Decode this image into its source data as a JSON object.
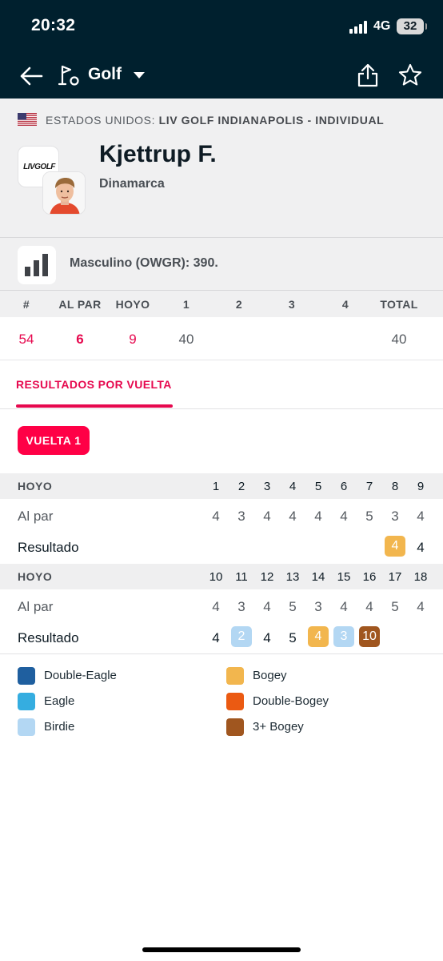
{
  "status_bar": {
    "time": "20:32",
    "network": "4G",
    "battery": "32"
  },
  "nav": {
    "title": "Golf"
  },
  "event": {
    "country": "ESTADOS UNIDOS:",
    "tournament": "LIV GOLF INDIANAPOLIS - INDIVIDUAL",
    "logo_text": "LIVGOLF"
  },
  "player": {
    "name": "Kjettrup F.",
    "country": "Dinamarca"
  },
  "ranking": {
    "text": "Masculino (OWGR): 390."
  },
  "summary": {
    "headers": [
      "#",
      "AL PAR",
      "HOYO",
      "1",
      "2",
      "3",
      "4",
      "TOTAL"
    ],
    "values": [
      "54",
      "6",
      "9",
      "40",
      "",
      "",
      "",
      "40"
    ]
  },
  "tabs": {
    "active": "RESULTADOS POR VUELTA"
  },
  "round_button": "VUELTA 1",
  "scorecard": {
    "hole_label": "HOYO",
    "par_label": "Al par",
    "result_label": "Resultado",
    "front": {
      "holes": [
        "1",
        "2",
        "3",
        "4",
        "5",
        "6",
        "7",
        "8",
        "9"
      ],
      "par": [
        "4",
        "3",
        "4",
        "4",
        "4",
        "4",
        "5",
        "3",
        "4"
      ],
      "result": [
        "",
        "",
        "",
        "",
        "",
        "",
        "",
        "4",
        "4"
      ],
      "result_types": [
        "",
        "",
        "",
        "",
        "",
        "",
        "",
        "bogey",
        "par"
      ]
    },
    "back": {
      "holes": [
        "10",
        "11",
        "12",
        "13",
        "14",
        "15",
        "16",
        "17",
        "18"
      ],
      "par": [
        "4",
        "3",
        "4",
        "5",
        "3",
        "4",
        "4",
        "5",
        "4"
      ],
      "result": [
        "4",
        "2",
        "4",
        "5",
        "4",
        "3",
        "10",
        "",
        ""
      ],
      "result_types": [
        "par",
        "birdie",
        "par",
        "par",
        "bogey",
        "birdie",
        "triple-plus-bogey",
        "",
        ""
      ]
    }
  },
  "legend": [
    {
      "label": "Double-Eagle",
      "color": "#1f5f9f"
    },
    {
      "label": "Bogey",
      "color": "#f2b64e"
    },
    {
      "label": "Eagle",
      "color": "#35ade0"
    },
    {
      "label": "Double-Bogey",
      "color": "#eb5a12"
    },
    {
      "label": "Birdie",
      "color": "#b3d7f3"
    },
    {
      "label": "3+ Bogey",
      "color": "#a0561f"
    }
  ],
  "colors": {
    "accent": "#e6084e",
    "header_bg": "#00202e",
    "bogey": "#f2b64e",
    "birdie": "#b3d7f3",
    "triple-plus-bogey": "#a0561f"
  }
}
